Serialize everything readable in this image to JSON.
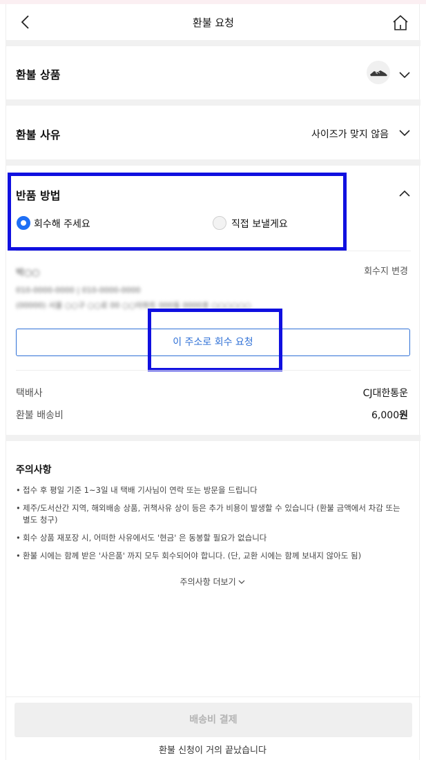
{
  "header": {
    "title": "환불 요청",
    "back_icon": "chevron-left-icon",
    "home_icon": "home-icon"
  },
  "product": {
    "label": "환불 상품",
    "thumbnail_icon": "sneaker-icon"
  },
  "reason": {
    "label": "환불 사유",
    "value": "사이즈가 맞지 않음"
  },
  "method": {
    "label": "반품 방법",
    "options": [
      {
        "label": "회수해 주세요",
        "selected": true
      },
      {
        "label": "직접 보낼게요",
        "selected": false
      }
    ]
  },
  "address": {
    "name": "박○○",
    "phones": "010-0000-0000 | 010-0000-0000",
    "line": "(00000) 서울 ○○구 ○○로 00 ○○아파트 000동 0000호 ○○○○○○",
    "change_label": "회수지 변경",
    "request_button": "이 주소로 회수 요청"
  },
  "shipping": {
    "carrier_label": "택배사",
    "carrier_value": "CJ대한통운",
    "fee_label": "환불 배송비",
    "fee_value": "6,000",
    "fee_unit": "원"
  },
  "notice": {
    "title": "주의사항",
    "items": [
      "접수 후 평일 기준 1~3일 내 택배 기사님이 연락 또는 방문을 드립니다",
      "제주/도서산간 지역, 해외배송 상품, 귀책사유 상이 등은 추가 비용이 발생할 수 있습니다 (환불 금액에서 차감 또는 별도 청구)",
      "회수 상품 재포장 시, 어떠한 사유에서도 '현금' 은 동봉할 필요가 없습니다",
      "환불 시에는 함께 받은 '사은품' 까지 모두 회수되어야 합니다. (단, 교환 시에는 함께 보내지 않아도 됨)"
    ],
    "more_label": "주의사항 더보기"
  },
  "footer": {
    "pay_button": "배송비 결제",
    "message": "환불 신청이 거의 끝났습니다"
  },
  "colors": {
    "accent": "#1e6ff5",
    "link": "#2d6fd6",
    "highlight": "#1010e0",
    "disabled_bg": "#efefef",
    "disabled_text": "#b3b3b3"
  }
}
